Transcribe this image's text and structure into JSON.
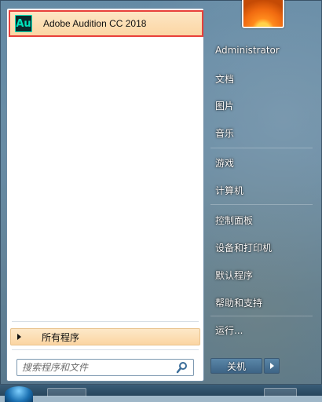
{
  "pinned": {
    "icon_text": "Au",
    "label": "Adobe Audition CC 2018"
  },
  "all_programs": {
    "label": "所有程序"
  },
  "search": {
    "placeholder": "搜索程序和文件"
  },
  "right_menu": {
    "items": [
      {
        "label": "Administrator"
      },
      {
        "label": "文档"
      },
      {
        "label": "图片"
      },
      {
        "label": "音乐"
      },
      {
        "label": "游戏"
      },
      {
        "label": "计算机"
      },
      {
        "label": "控制面板"
      },
      {
        "label": "设备和打印机"
      },
      {
        "label": "默认程序"
      },
      {
        "label": "帮助和支持"
      },
      {
        "label": "运行..."
      }
    ]
  },
  "shutdown": {
    "label": "关机"
  },
  "colors": {
    "highlight_border": "#e8403a",
    "highlight_fill": "#fbd6a4",
    "audition_teal": "#00e4bb"
  }
}
